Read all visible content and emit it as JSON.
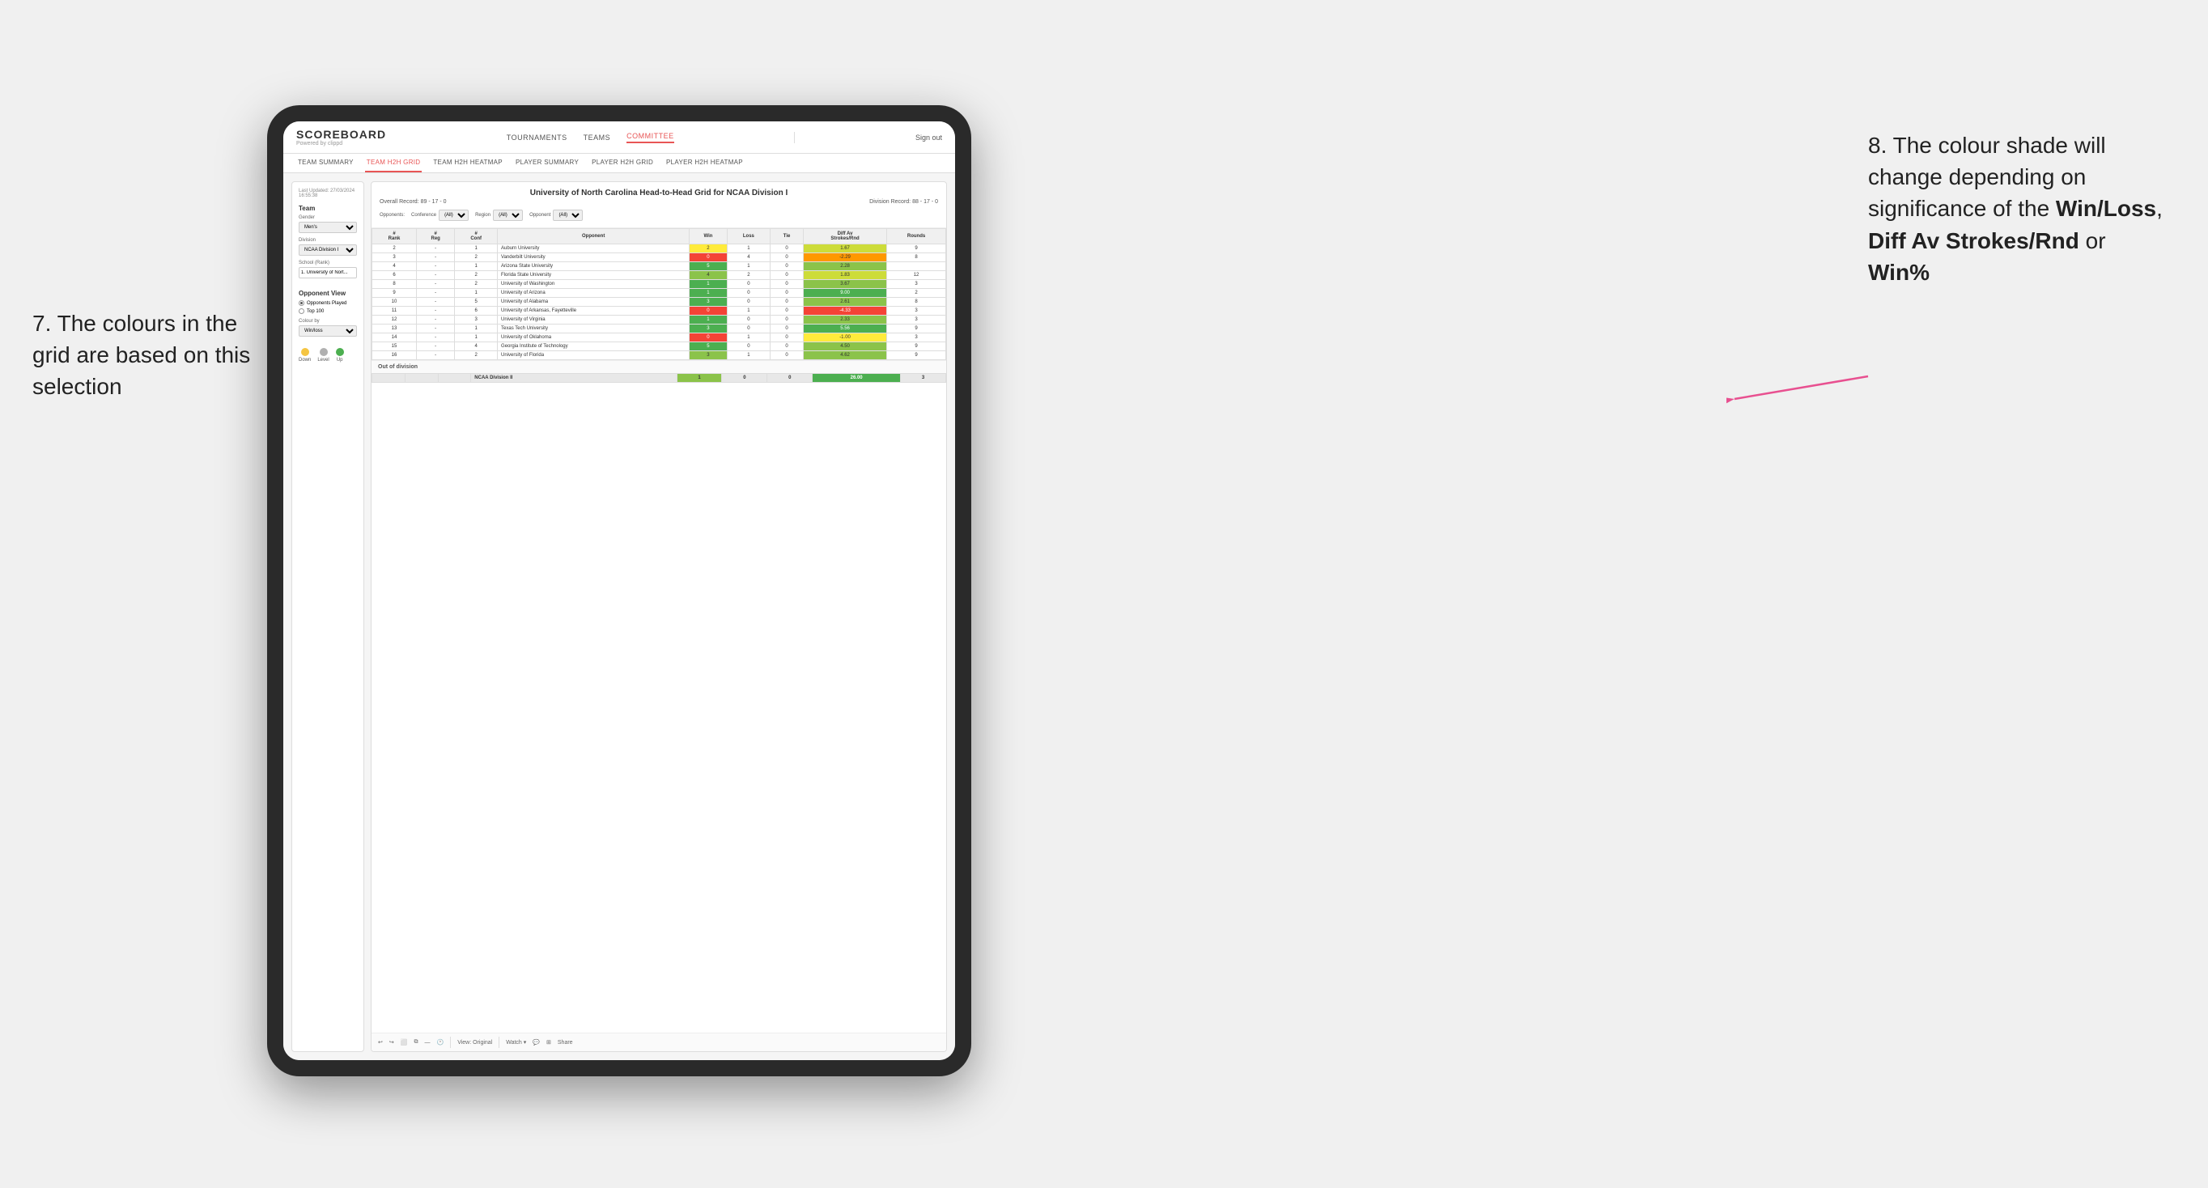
{
  "annotations": {
    "left_title": "7. The colours in the grid are based on this selection",
    "right_title": "8. The colour shade will change depending on significance of the ",
    "right_bold1": "Win/Loss",
    "right_comma": ", ",
    "right_bold2": "Diff Av Strokes/Rnd",
    "right_or": " or",
    "right_bold3": "Win%"
  },
  "header": {
    "logo": "SCOREBOARD",
    "logo_sub": "Powered by clippd",
    "nav": [
      "TOURNAMENTS",
      "TEAMS",
      "COMMITTEE"
    ],
    "sign_out": "Sign out"
  },
  "sub_nav": {
    "items": [
      "TEAM SUMMARY",
      "TEAM H2H GRID",
      "TEAM H2H HEATMAP",
      "PLAYER SUMMARY",
      "PLAYER H2H GRID",
      "PLAYER H2H HEATMAP"
    ],
    "active": "TEAM H2H GRID"
  },
  "left_panel": {
    "timestamp_label": "Last Updated: 27/03/2024",
    "timestamp_time": "16:55:38",
    "team_label": "Team",
    "gender_label": "Gender",
    "gender_value": "Men's",
    "division_label": "Division",
    "division_value": "NCAA Division I",
    "school_label": "School (Rank)",
    "school_value": "1. University of Nort...",
    "opponent_view_label": "Opponent View",
    "radio_opponents": "Opponents Played",
    "radio_top100": "Top 100",
    "colour_by_label": "Colour by",
    "colour_by_value": "Win/loss",
    "legend_down": "Down",
    "legend_level": "Level",
    "legend_up": "Up"
  },
  "grid": {
    "title": "University of North Carolina Head-to-Head Grid for NCAA Division I",
    "overall_record_label": "Overall Record:",
    "overall_record": "89 - 17 - 0",
    "division_record_label": "Division Record:",
    "division_record": "88 - 17 - 0",
    "filters": {
      "opponents_label": "Opponents:",
      "conference_label": "Conference",
      "conference_value": "(All)",
      "region_label": "Region",
      "region_value": "(All)",
      "opponent_label": "Opponent",
      "opponent_value": "(All)"
    },
    "col_headers": [
      "#\nRank",
      "#\nReg",
      "#\nConf",
      "Opponent",
      "Win",
      "Loss",
      "Tie",
      "Diff Av\nStrokes/Rnd",
      "Rounds"
    ],
    "rows": [
      {
        "rank": "2",
        "reg": "-",
        "conf": "1",
        "opponent": "Auburn University",
        "win": "2",
        "loss": "1",
        "tie": "0",
        "diff": "1.67",
        "rounds": "9",
        "win_color": "yellow",
        "diff_color": "green_light"
      },
      {
        "rank": "3",
        "reg": "-",
        "conf": "2",
        "opponent": "Vanderbilt University",
        "win": "0",
        "loss": "4",
        "tie": "0",
        "diff": "-2.29",
        "rounds": "8",
        "win_color": "red",
        "diff_color": "orange"
      },
      {
        "rank": "4",
        "reg": "-",
        "conf": "1",
        "opponent": "Arizona State University",
        "win": "5",
        "loss": "1",
        "tie": "0",
        "diff": "2.28",
        "rounds": "",
        "win_color": "green_dark",
        "diff_color": "green_mid"
      },
      {
        "rank": "6",
        "reg": "-",
        "conf": "2",
        "opponent": "Florida State University",
        "win": "4",
        "loss": "2",
        "tie": "0",
        "diff": "1.83",
        "rounds": "12",
        "win_color": "green_mid",
        "diff_color": "green_light"
      },
      {
        "rank": "8",
        "reg": "-",
        "conf": "2",
        "opponent": "University of Washington",
        "win": "1",
        "loss": "0",
        "tie": "0",
        "diff": "3.67",
        "rounds": "3",
        "win_color": "green_dark",
        "diff_color": "green_mid"
      },
      {
        "rank": "9",
        "reg": "-",
        "conf": "1",
        "opponent": "University of Arizona",
        "win": "1",
        "loss": "0",
        "tie": "0",
        "diff": "9.00",
        "rounds": "2",
        "win_color": "green_dark",
        "diff_color": "green_dark"
      },
      {
        "rank": "10",
        "reg": "-",
        "conf": "5",
        "opponent": "University of Alabama",
        "win": "3",
        "loss": "0",
        "tie": "0",
        "diff": "2.61",
        "rounds": "8",
        "win_color": "green_dark",
        "diff_color": "green_mid"
      },
      {
        "rank": "11",
        "reg": "-",
        "conf": "6",
        "opponent": "University of Arkansas, Fayetteville",
        "win": "0",
        "loss": "1",
        "tie": "0",
        "diff": "-4.33",
        "rounds": "3",
        "win_color": "red",
        "diff_color": "red"
      },
      {
        "rank": "12",
        "reg": "-",
        "conf": "3",
        "opponent": "University of Virginia",
        "win": "1",
        "loss": "0",
        "tie": "0",
        "diff": "2.33",
        "rounds": "3",
        "win_color": "green_dark",
        "diff_color": "green_mid"
      },
      {
        "rank": "13",
        "reg": "-",
        "conf": "1",
        "opponent": "Texas Tech University",
        "win": "3",
        "loss": "0",
        "tie": "0",
        "diff": "5.56",
        "rounds": "9",
        "win_color": "green_dark",
        "diff_color": "green_dark"
      },
      {
        "rank": "14",
        "reg": "-",
        "conf": "1",
        "opponent": "University of Oklahoma",
        "win": "0",
        "loss": "1",
        "tie": "0",
        "diff": "-1.00",
        "rounds": "3",
        "win_color": "red",
        "diff_color": "yellow"
      },
      {
        "rank": "15",
        "reg": "-",
        "conf": "4",
        "opponent": "Georgia Institute of Technology",
        "win": "5",
        "loss": "0",
        "tie": "0",
        "diff": "4.50",
        "rounds": "9",
        "win_color": "green_dark",
        "diff_color": "green_mid"
      },
      {
        "rank": "16",
        "reg": "-",
        "conf": "2",
        "opponent": "University of Florida",
        "win": "3",
        "loss": "1",
        "tie": "0",
        "diff": "4.62",
        "rounds": "9",
        "win_color": "green_mid",
        "diff_color": "green_mid"
      }
    ],
    "out_division_label": "Out of division",
    "out_division_row": {
      "label": "NCAA Division II",
      "win": "1",
      "loss": "0",
      "tie": "0",
      "diff": "26.00",
      "rounds": "3"
    },
    "toolbar": {
      "view_label": "View: Original",
      "watch_label": "Watch ▾",
      "share_label": "Share"
    }
  },
  "colors": {
    "accent": "#e85555",
    "green_dark": "#4caf50",
    "green_mid": "#8bc34a",
    "green_light": "#cddc39",
    "yellow": "#ffeb3b",
    "orange": "#ff9800",
    "red": "#f44336",
    "legend_down": "#f5c542",
    "legend_level": "#b0b0b0",
    "legend_up": "#4caf50"
  }
}
